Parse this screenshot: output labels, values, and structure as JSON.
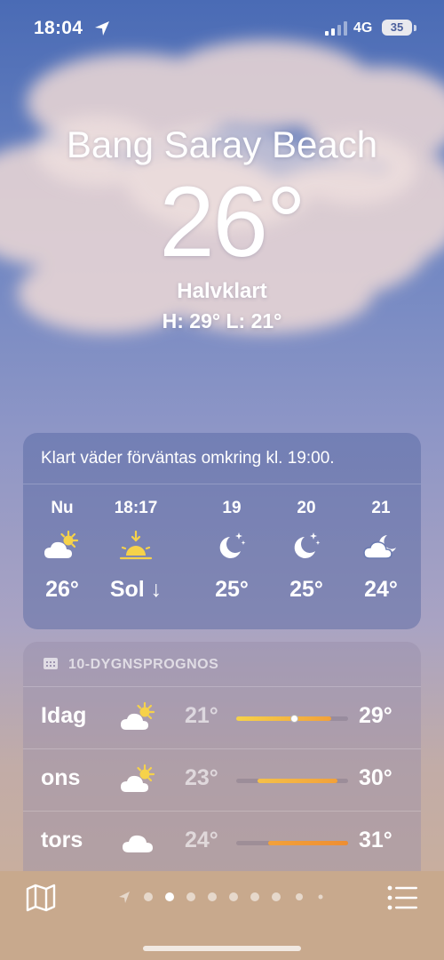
{
  "status_bar": {
    "time": "18:04",
    "network": "4G",
    "battery": "35",
    "location_icon": "location-arrow-icon",
    "signal_icon": "cellular-signal-icon"
  },
  "weather": {
    "location": "Bang Saray Beach",
    "temperature": "26°",
    "condition": "Halvklart",
    "high_low": "H: 29°  L: 21°"
  },
  "hourly": {
    "summary": "Klart väder förväntas omkring kl. 19:00.",
    "items": [
      {
        "label": "Nu",
        "icon": "partly-sunny-icon",
        "value": "26°"
      },
      {
        "label": "18:17",
        "icon": "sunset-icon",
        "value": "Sol ↓"
      },
      {
        "label": "19",
        "icon": "moon-stars-icon",
        "value": "25°"
      },
      {
        "label": "20",
        "icon": "moon-stars-icon",
        "value": "25°"
      },
      {
        "label": "21",
        "icon": "cloudy-night-icon",
        "value": "24°"
      }
    ]
  },
  "forecast": {
    "title": "10-DYGNSPROGNOS",
    "title_icon": "calendar-icon",
    "days": [
      {
        "day": "Idag",
        "icon": "partly-sunny-icon",
        "low": "21°",
        "high": "29°",
        "range_start": 0.0,
        "range_end": 0.85,
        "current_position": 0.52
      },
      {
        "day": "ons",
        "icon": "partly-sunny-icon",
        "low": "23°",
        "high": "30°",
        "range_start": 0.18,
        "range_end": 0.9
      },
      {
        "day": "tors",
        "icon": "cloud-icon",
        "low": "24°",
        "high": "31°",
        "range_start": 0.28,
        "range_end": 1.0
      }
    ]
  },
  "bottom_bar": {
    "map_icon": "map-icon",
    "list_icon": "list-icon",
    "page_count": 9,
    "current_page": 2
  },
  "colors": {
    "accent_yellow": "#f6d24a",
    "accent_orange": "#f2a13a",
    "bottom_bar": "#c8a98d"
  }
}
